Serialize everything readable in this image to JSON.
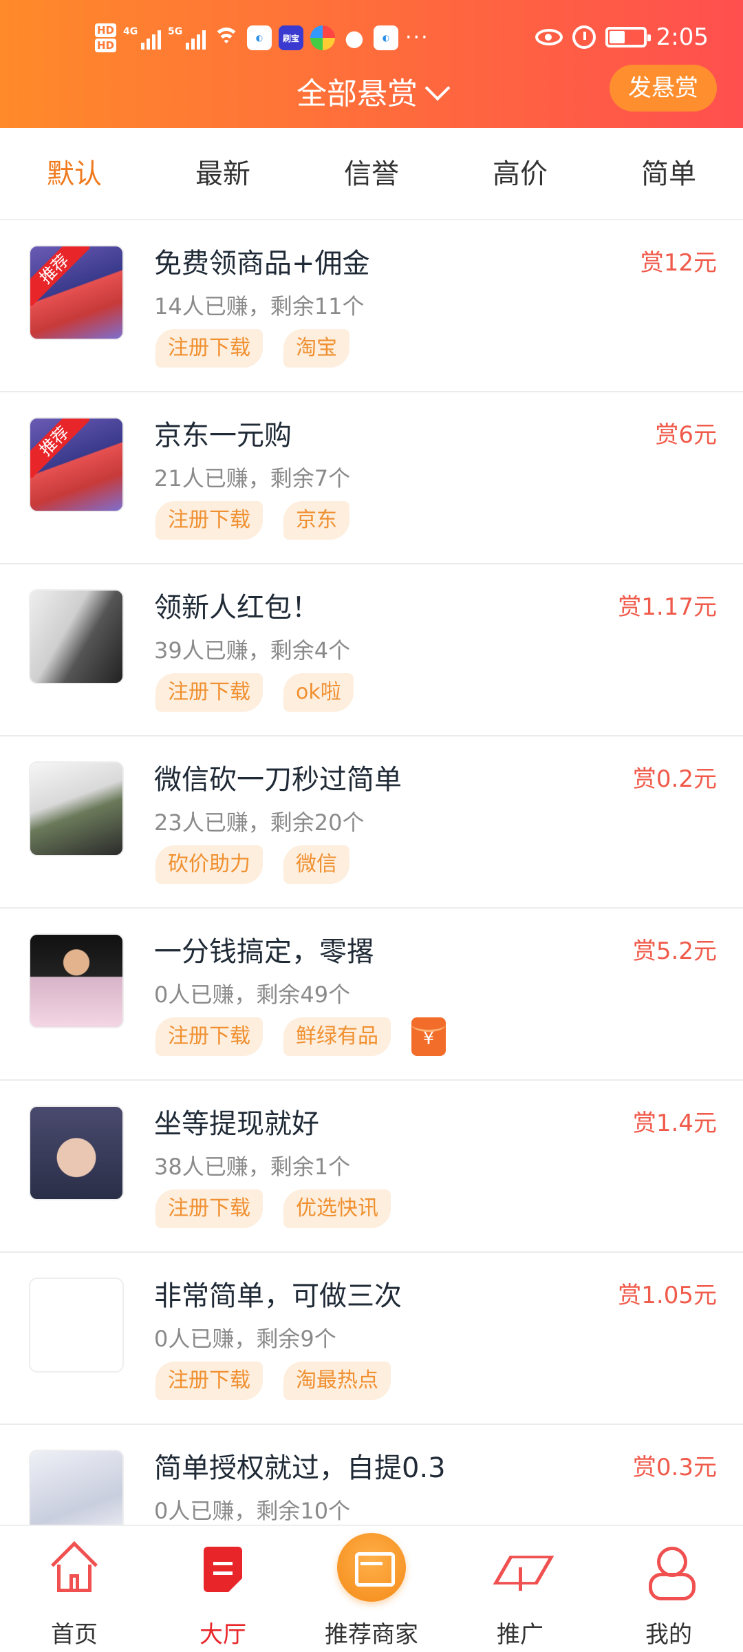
{
  "status_bar": {
    "hd1": "HD",
    "hd2": "HD",
    "net1": "4G",
    "net2": "5G",
    "app_badge": "刷宝",
    "more": "···",
    "time": "2:05"
  },
  "header": {
    "title": "全部悬赏",
    "post_button": "发悬赏"
  },
  "tabs": [
    "默认",
    "最新",
    "信誉",
    "高价",
    "简单"
  ],
  "tasks": [
    {
      "title": "免费领商品+佣金",
      "earned": "14人已赚，剩余11个",
      "tags": [
        "注册下载",
        "淘宝"
      ],
      "reward": "赏12元",
      "badge": "推荐"
    },
    {
      "title": "京东一元购",
      "earned": "21人已赚，剩余7个",
      "tags": [
        "注册下载",
        "京东"
      ],
      "reward": "赏6元",
      "badge": "推荐"
    },
    {
      "title": "领新人红包！",
      "earned": "39人已赚，剩余4个",
      "tags": [
        "注册下载",
        "ok啦"
      ],
      "reward": "赏1.17元"
    },
    {
      "title": "微信砍一刀秒过简单",
      "earned": "23人已赚，剩余20个",
      "tags": [
        "砍价助力",
        "微信"
      ],
      "reward": "赏0.2元"
    },
    {
      "title": "一分钱搞定，零撂",
      "earned": "0人已赚，剩余49个",
      "tags": [
        "注册下载",
        "鲜绿有品"
      ],
      "reward": "赏5.2元",
      "redpack": "¥"
    },
    {
      "title": "坐等提现就好",
      "earned": "38人已赚，剩余1个",
      "tags": [
        "注册下载",
        "优选快讯"
      ],
      "reward": "赏1.4元"
    },
    {
      "title": "非常简单，可做三次",
      "earned": "0人已赚，剩余9个",
      "tags": [
        "注册下载",
        "淘最热点"
      ],
      "reward": "赏1.05元"
    },
    {
      "title": "简单授权就过，自提0.3",
      "earned": "0人已赚，剩余10个",
      "tags": [],
      "reward": "赏0.3元"
    }
  ],
  "bottom_nav": [
    "首页",
    "大厅",
    "推荐商家",
    "推广",
    "我的"
  ],
  "colors": {
    "accent_orange": "#f07a1e",
    "reward_red": "#f05a4a",
    "nav_active": "#e8262a",
    "tag_text": "#f09030",
    "tag_bg": "#fdeede"
  },
  "icons": {
    "home": "home-icon",
    "hall": "hall-icon",
    "merchant": "shop-icon",
    "promote": "box-icon",
    "me": "user-icon"
  }
}
